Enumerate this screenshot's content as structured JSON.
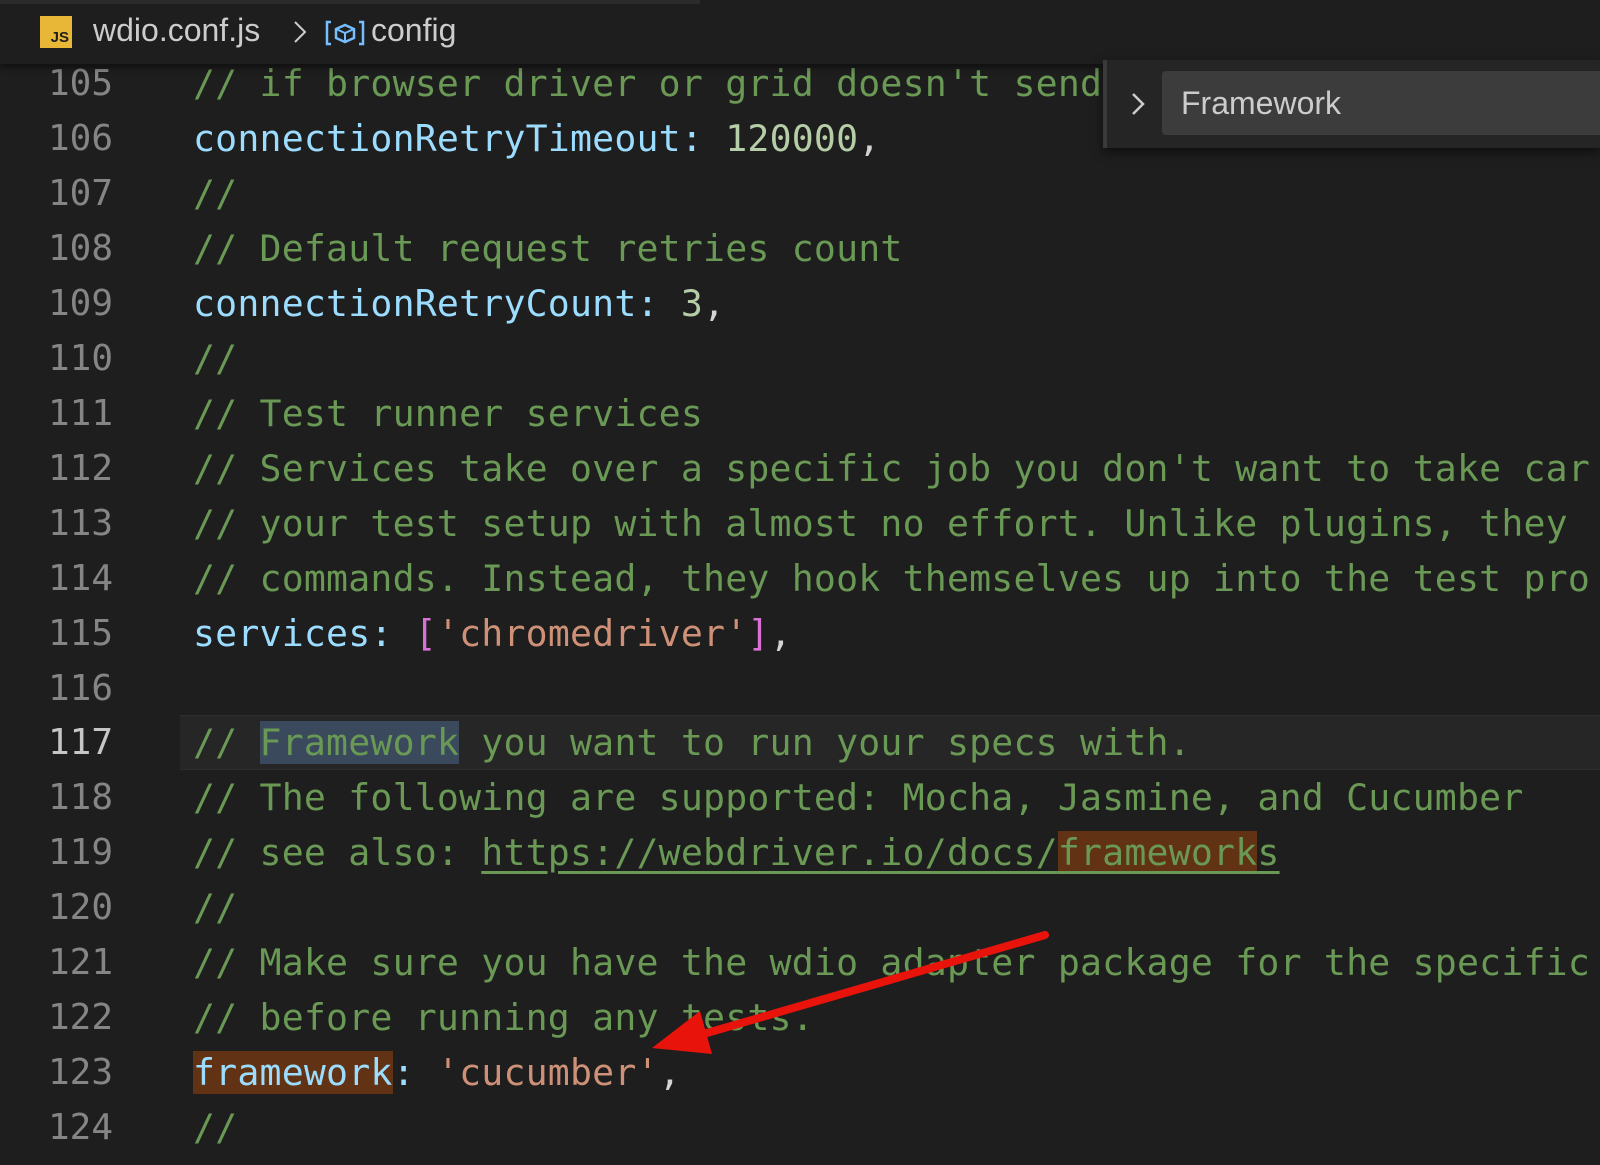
{
  "breadcrumb": {
    "file_badge": "JS",
    "file_name": "wdio.conf.js",
    "symbol_name": "config"
  },
  "find_widget": {
    "query": "Framework"
  },
  "editor": {
    "active_line": "117",
    "lines": [
      {
        "num": "105",
        "seg": [
          "// if browser driver or grid doesn't send"
        ]
      },
      {
        "num": "106",
        "seg": [
          "connectionRetryTimeout",
          ": ",
          "120000",
          ","
        ]
      },
      {
        "num": "107",
        "seg": [
          "//"
        ]
      },
      {
        "num": "108",
        "seg": [
          "// Default request retries count"
        ]
      },
      {
        "num": "109",
        "seg": [
          "connectionRetryCount",
          ": ",
          "3",
          ","
        ]
      },
      {
        "num": "110",
        "seg": [
          "//"
        ]
      },
      {
        "num": "111",
        "seg": [
          "// Test runner services"
        ]
      },
      {
        "num": "112",
        "seg": [
          "// Services take over a specific job you don't want to take car"
        ]
      },
      {
        "num": "113",
        "seg": [
          "// your test setup with almost no effort. Unlike plugins, they"
        ]
      },
      {
        "num": "114",
        "seg": [
          "// commands. Instead, they hook themselves up into the test pro"
        ]
      },
      {
        "num": "115",
        "seg": [
          "services",
          ": ",
          "[",
          "'chromedriver'",
          "]",
          ","
        ]
      },
      {
        "num": "116",
        "seg": [
          ""
        ]
      },
      {
        "num": "117",
        "seg": [
          "// ",
          "Framework",
          " you want to run your specs with."
        ]
      },
      {
        "num": "118",
        "seg": [
          "// The following are supported: Mocha, Jasmine, and Cucumber"
        ]
      },
      {
        "num": "119",
        "seg": [
          "// see also: ",
          "https://webdriver.io/docs/",
          "framework",
          "s"
        ]
      },
      {
        "num": "120",
        "seg": [
          "//"
        ]
      },
      {
        "num": "121",
        "seg": [
          "// Make sure you have the wdio adapter package for the specific"
        ]
      },
      {
        "num": "122",
        "seg": [
          "// before running any tests."
        ]
      },
      {
        "num": "123",
        "seg": [
          "framework",
          ": ",
          "'cucumber'",
          ","
        ]
      },
      {
        "num": "124",
        "seg": [
          "//"
        ]
      }
    ]
  },
  "colors": {
    "comment": "#6a9955",
    "property": "#9cdcfe",
    "number": "#b5cea8",
    "string": "#ce9178",
    "find_match": "#613214",
    "selection": "#3a4a5c",
    "arrow": "#e8140c"
  }
}
